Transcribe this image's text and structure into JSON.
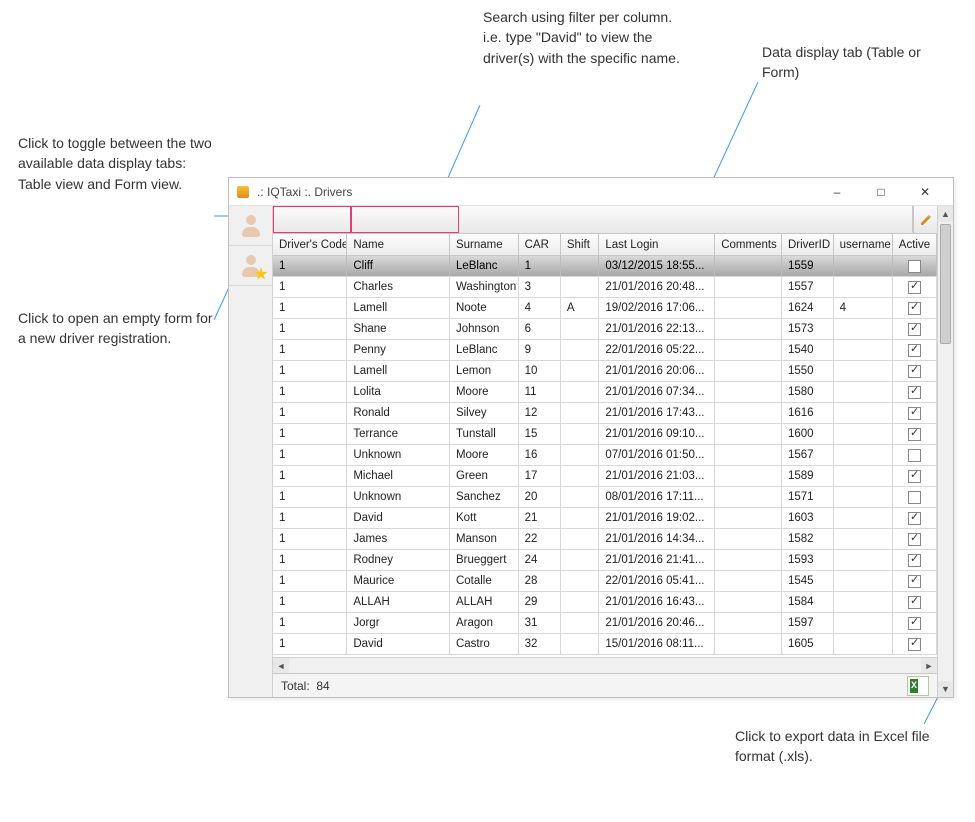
{
  "window": {
    "title": ".: IQTaxi :. Drivers"
  },
  "callouts": {
    "toggle": "Click to toggle between the two available data display tabs:  Table view and Form view.",
    "newform": "Click to open an empty form for a new driver registration.",
    "filter": "Search using filter per column.\ni.e. type \"David\" to view the driver(s) with the specific name.",
    "tab": "Data display tab (Table or Form)",
    "export": "Click to export data in Excel file format (.xls)."
  },
  "grid": {
    "headers": {
      "code": "Driver's Code",
      "name": "Name",
      "surname": "Surname",
      "car": "CAR",
      "shift": "Shift",
      "login": "Last Login",
      "comments": "Comments",
      "driverid": "DriverID",
      "username": "username",
      "active": "Active"
    },
    "rows": [
      {
        "code": "1",
        "name": "Cliff",
        "surname": "LeBlanc",
        "car": "1",
        "shift": "",
        "login": "03/12/2015 18:55...",
        "comments": "",
        "driverid": "1559",
        "username": "",
        "active": false,
        "selected": true
      },
      {
        "code": "1",
        "name": "Charles",
        "surname": "Washington",
        "car": "3",
        "shift": "",
        "login": "21/01/2016 20:48...",
        "comments": "",
        "driverid": "1557",
        "username": "",
        "active": true
      },
      {
        "code": "1",
        "name": "Lamell",
        "surname": "Noote",
        "car": "4",
        "shift": "A",
        "login": "19/02/2016 17:06...",
        "comments": "",
        "driverid": "1624",
        "username": "4",
        "active": true
      },
      {
        "code": "1",
        "name": "Shane",
        "surname": "Johnson",
        "car": "6",
        "shift": "",
        "login": "21/01/2016 22:13...",
        "comments": "",
        "driverid": "1573",
        "username": "",
        "active": true
      },
      {
        "code": "1",
        "name": "Penny",
        "surname": "LeBlanc",
        "car": "9",
        "shift": "",
        "login": "22/01/2016 05:22...",
        "comments": "",
        "driverid": "1540",
        "username": "",
        "active": true
      },
      {
        "code": "1",
        "name": "Lamell",
        "surname": "Lemon",
        "car": "10",
        "shift": "",
        "login": "21/01/2016 20:06...",
        "comments": "",
        "driverid": "1550",
        "username": "",
        "active": true
      },
      {
        "code": "1",
        "name": "Lolita",
        "surname": "Moore",
        "car": "11",
        "shift": "",
        "login": "21/01/2016 07:34...",
        "comments": "",
        "driverid": "1580",
        "username": "",
        "active": true
      },
      {
        "code": "1",
        "name": "Ronald",
        "surname": "Silvey",
        "car": "12",
        "shift": "",
        "login": "21/01/2016 17:43...",
        "comments": "",
        "driverid": "1616",
        "username": "",
        "active": true
      },
      {
        "code": "1",
        "name": "Terrance",
        "surname": "Tunstall",
        "car": "15",
        "shift": "",
        "login": "21/01/2016 09:10...",
        "comments": "",
        "driverid": "1600",
        "username": "",
        "active": true
      },
      {
        "code": "1",
        "name": "Unknown",
        "surname": "Moore",
        "car": "16",
        "shift": "",
        "login": "07/01/2016 01:50...",
        "comments": "",
        "driverid": "1567",
        "username": "",
        "active": false
      },
      {
        "code": "1",
        "name": "Michael",
        "surname": "Green",
        "car": "17",
        "shift": "",
        "login": "21/01/2016 21:03...",
        "comments": "",
        "driverid": "1589",
        "username": "",
        "active": true
      },
      {
        "code": "1",
        "name": "Unknown",
        "surname": "Sanchez",
        "car": "20",
        "shift": "",
        "login": "08/01/2016 17:11...",
        "comments": "",
        "driverid": "1571",
        "username": "",
        "active": false
      },
      {
        "code": "1",
        "name": "David",
        "surname": "Kott",
        "car": "21",
        "shift": "",
        "login": "21/01/2016 19:02...",
        "comments": "",
        "driverid": "1603",
        "username": "",
        "active": true
      },
      {
        "code": "1",
        "name": "James",
        "surname": "Manson",
        "car": "22",
        "shift": "",
        "login": "21/01/2016 14:34...",
        "comments": "",
        "driverid": "1582",
        "username": "",
        "active": true
      },
      {
        "code": "1",
        "name": "Rodney",
        "surname": "Brueggert",
        "car": "24",
        "shift": "",
        "login": "21/01/2016 21:41...",
        "comments": "",
        "driverid": "1593",
        "username": "",
        "active": true
      },
      {
        "code": "1",
        "name": "Maurice",
        "surname": "Cotalle",
        "car": "28",
        "shift": "",
        "login": "22/01/2016 05:41...",
        "comments": "",
        "driverid": "1545",
        "username": "",
        "active": true
      },
      {
        "code": "1",
        "name": "ALLAH",
        "surname": "ALLAH",
        "car": "29",
        "shift": "",
        "login": "21/01/2016 16:43...",
        "comments": "",
        "driverid": "1584",
        "username": "",
        "active": true
      },
      {
        "code": "1",
        "name": "Jorgr",
        "surname": "Aragon",
        "car": "31",
        "shift": "",
        "login": "21/01/2016 20:46...",
        "comments": "",
        "driverid": "1597",
        "username": "",
        "active": true
      },
      {
        "code": "1",
        "name": "David",
        "surname": "Castro",
        "car": "32",
        "shift": "",
        "login": "15/01/2016 08:11...",
        "comments": "",
        "driverid": "1605",
        "username": "",
        "active": true
      }
    ]
  },
  "status": {
    "total_label": "Total:",
    "total_value": "84"
  }
}
